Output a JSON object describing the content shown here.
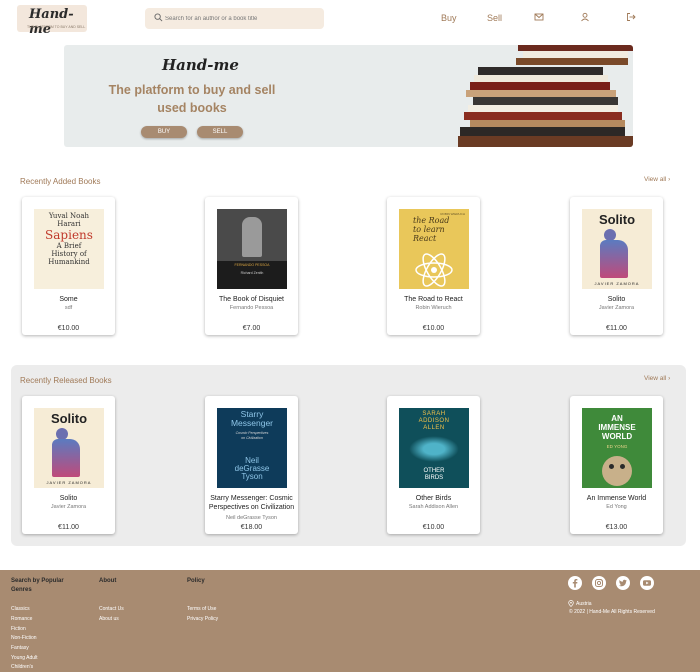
{
  "header": {
    "logo_text": "Hand-me",
    "logo_tagline": "THE PLATFORM TO BUY AND SELL",
    "search_placeholder": "Search for an author or a book title",
    "nav_buy": "Buy",
    "nav_sell": "Sell",
    "icons": [
      "mail-icon",
      "user-icon",
      "logout-icon"
    ]
  },
  "hero": {
    "logo": "Hand-me",
    "title": "The platform to buy and sell used books",
    "buy_label": "BUY",
    "sell_label": "SELL"
  },
  "recently_added": {
    "title": "Recently Added Books",
    "view_all": "View all",
    "books": [
      {
        "title": "Some",
        "author": "sdf",
        "price": "€10.00",
        "cover": [
          "Yuval Noah",
          "Harari",
          "Sapiens",
          "A Brief",
          "History of",
          "Humankind"
        ]
      },
      {
        "title": "The Book of Disquiet",
        "author": "Fernando Pessoa",
        "price": "€7.00",
        "cover": [
          "FERNANDO PESSOA",
          "Richard Zenith"
        ]
      },
      {
        "title": "The Road to React",
        "author": "Robin Wieruch",
        "price": "€10.00",
        "cover": [
          "ROBIN WIERUCH",
          "the Road",
          "to learn",
          "React"
        ]
      },
      {
        "title": "Solito",
        "author": "Javier Zamora",
        "price": "€11.00",
        "cover": [
          "Solito",
          "JAVIER ZAMORA"
        ]
      }
    ]
  },
  "recently_released": {
    "title": "Recently Released Books",
    "view_all": "View all",
    "books": [
      {
        "title": "Solito",
        "author": "Javier Zamora",
        "price": "€11.00",
        "cover": [
          "Solito",
          "JAVIER ZAMORA"
        ]
      },
      {
        "title": "Starry Messenger: Cosmic Perspectives on Civilization",
        "author": "Neil deGrasse Tyson",
        "price": "€18.00",
        "cover": [
          "Starry",
          "Messenger",
          "Cosmic Perspectives",
          "on Civilization",
          "Neil",
          "deGrasse",
          "Tyson"
        ]
      },
      {
        "title": "Other Birds",
        "author": "Sarah Addison Allen",
        "price": "€10.00",
        "cover": [
          "SARAH",
          "ADDISON",
          "ALLEN",
          "OTHER",
          "BIRDS"
        ]
      },
      {
        "title": "An Immense World",
        "author": "Ed Yong",
        "price": "€13.00",
        "cover": [
          "AN",
          "IMMENSE",
          "WORLD",
          "ED YONG"
        ]
      }
    ]
  },
  "footer": {
    "col1_title": "Search by Popular Genres",
    "genres": [
      "Classics",
      "Romance",
      "Fiction",
      "Non-Fiction",
      "Fantasy",
      "Young Adult",
      "Children's"
    ],
    "col2_title": "About",
    "about_links": [
      "Contact Us",
      "About us"
    ],
    "col3_title": "Policy",
    "policy_links": [
      "Terms of Use",
      "Privacy Policy"
    ],
    "social_icons": [
      "facebook-icon",
      "instagram-icon",
      "twitter-icon",
      "youtube-icon"
    ],
    "location": "Austria",
    "copyright": "© 2022 | Hand-Me All Rights Reserved"
  },
  "colors": {
    "accent": "#a88b71",
    "text_accent": "#a07a58",
    "hero_bg": "#e8ecec"
  }
}
